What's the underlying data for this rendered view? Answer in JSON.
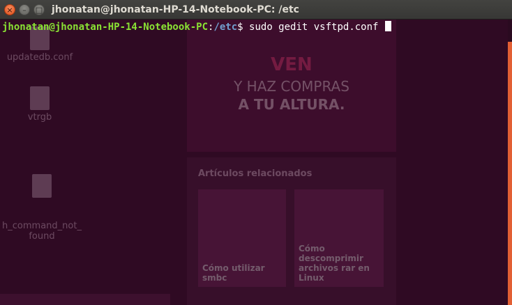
{
  "window": {
    "title": "jhonatan@jhonatan-HP-14-Notebook-PC: /etc",
    "close_glyph": "×",
    "minimize_glyph": "–",
    "maximize_glyph": "□"
  },
  "terminal": {
    "user_host": "jhonatan@jhonatan-HP-14-Notebook-PC",
    "separator": ":",
    "path": "/etc",
    "prompt_symbol": "$",
    "command": " sudo gedit vsftpd.conf "
  },
  "background_ghost": {
    "files": [
      {
        "label": "updatedb.conf"
      },
      {
        "label": "vtrgb"
      },
      {
        "label": "h_command_not_\nfound"
      }
    ],
    "banner": {
      "line1": "VEN",
      "line2": "Y HAZ COMPRAS",
      "line3": "A TU ALTURA."
    },
    "panel_title": "Artículos relacionados",
    "cards": [
      {
        "label": "Cómo utilizar smbc"
      },
      {
        "label": "Cómo descomprimir archivos rar en Linux"
      }
    ]
  },
  "colors": {
    "terminal_bg": "#300a24",
    "user_host": "#8ae234",
    "path": "#729fcf",
    "scrollbar": "#e25f34"
  }
}
